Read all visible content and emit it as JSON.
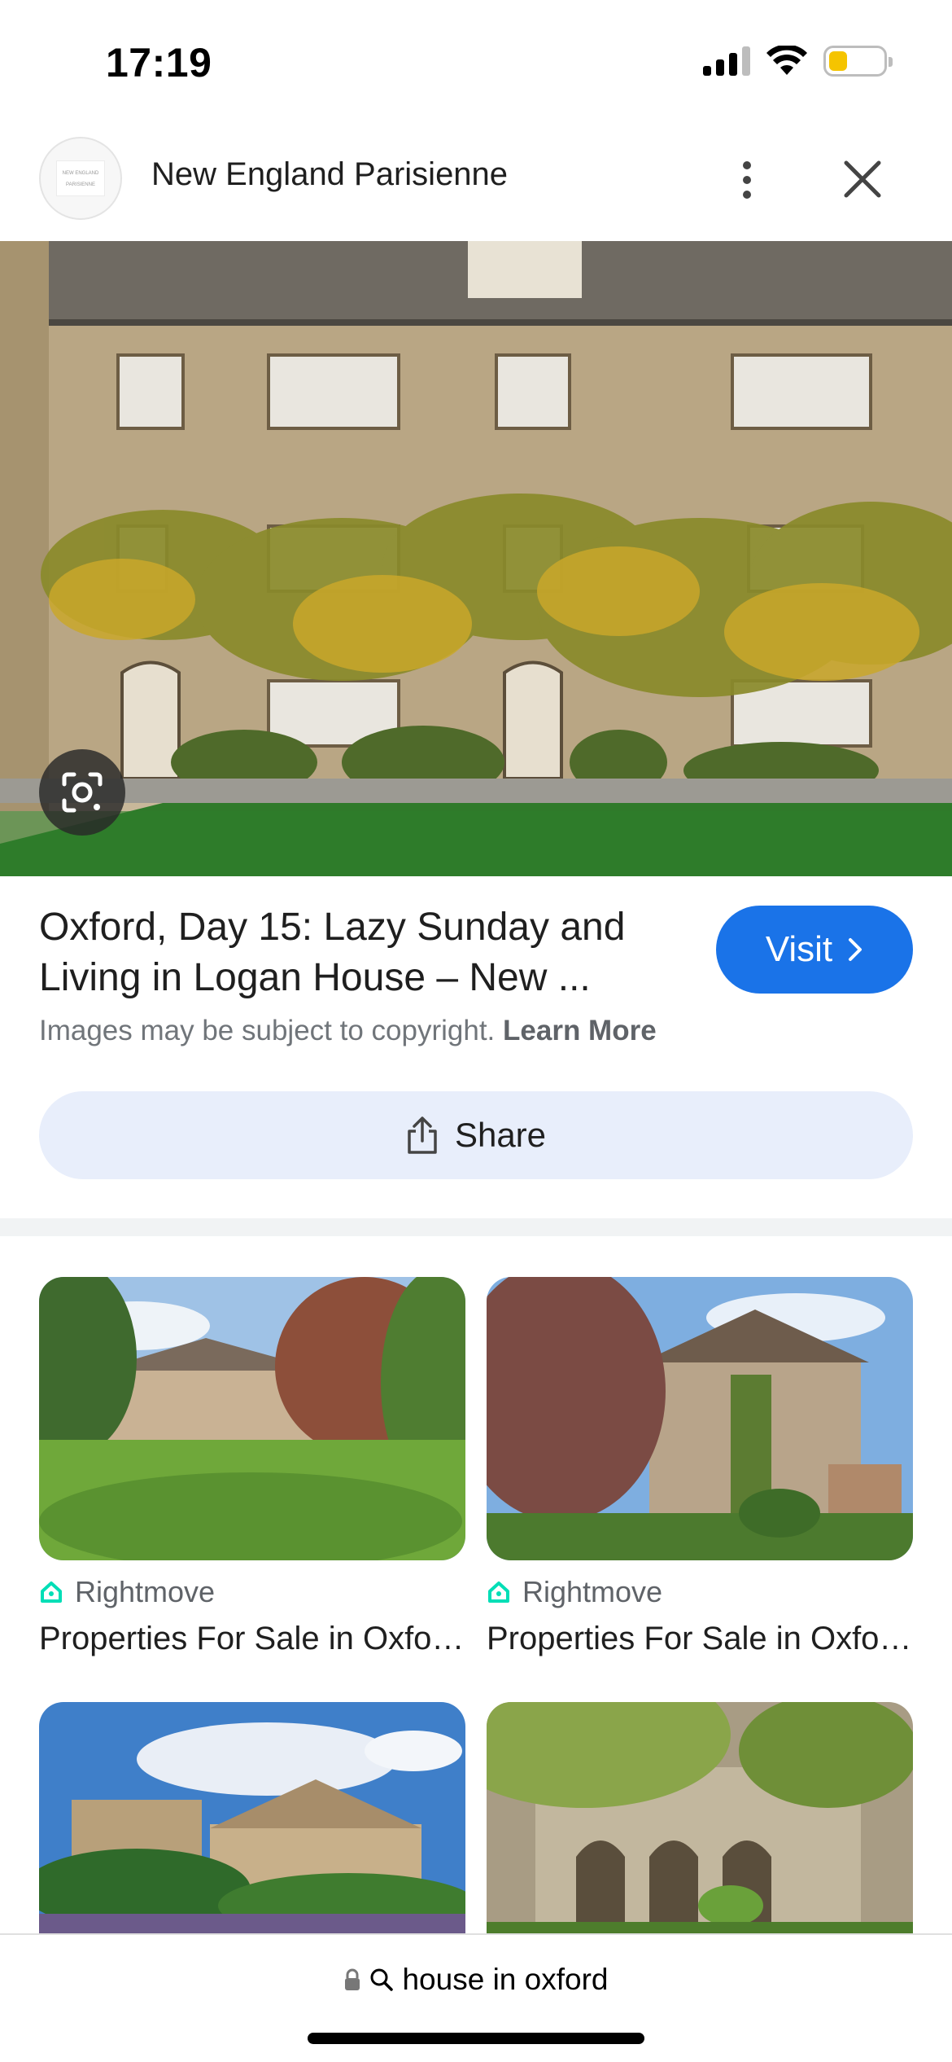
{
  "status_bar": {
    "time": "17:19",
    "icons": [
      "cellular-signal-icon",
      "wifi-icon",
      "battery-icon"
    ],
    "battery_level": 0.35,
    "battery_color": "#f5c400"
  },
  "header": {
    "site_name": "New England Parisienne",
    "logo_text": "NEW ENGLAND PARISIENNE",
    "more_icon": "vertical-dots-icon",
    "close_icon": "close-icon"
  },
  "hero": {
    "lens_icon": "google-lens-icon"
  },
  "result": {
    "title": "Oxford, Day 15: Lazy Sunday and Living in Logan House – New ...",
    "visit_label": "Visit",
    "visit_color": "#1a73e8",
    "copyright_text": "Images may be subject to copyright.",
    "learn_more": "Learn More",
    "share_label": "Share"
  },
  "related": [
    {
      "source": "Rightmove",
      "title": "Properties For Sale in Oxford | Rightmove"
    },
    {
      "source": "Rightmove",
      "title": "Properties For Sale in Oxford | Rightmove"
    },
    {
      "source": "",
      "title": ""
    },
    {
      "source": "",
      "title": ""
    }
  ],
  "bottom_bar": {
    "url_text": "house in oxford",
    "lock_icon": "lock-icon",
    "search_icon": "search-icon"
  }
}
